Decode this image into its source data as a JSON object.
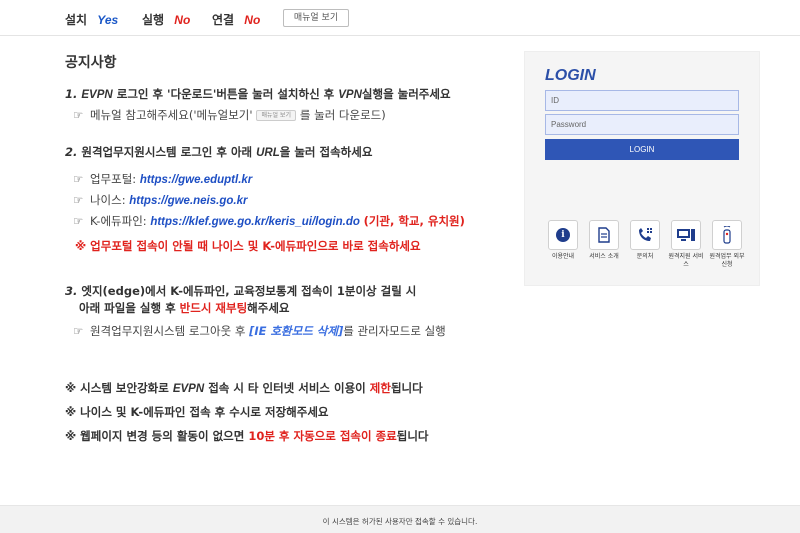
{
  "topbar": {
    "install_label": "설치",
    "install_value": "Yes",
    "run_label": "실행",
    "run_value": "No",
    "connect_label": "연결",
    "connect_value": "No",
    "manual_button": "매뉴얼 보기"
  },
  "notice": {
    "title": "공지사항",
    "item1": {
      "num": "1.",
      "evpn": "EVPN",
      "text_a": "로그인 후 '다운로드'버튼을 눌러 설치하신 후",
      "vpn": "VPN",
      "text_b": "실행을 눌러주세요",
      "sub_a": "메뉴얼 참고해주세요('메뉴얼보기'",
      "mini_btn": "매뉴얼 보기",
      "sub_b": "를 눌러 다운로드)"
    },
    "item2": {
      "num": "2.",
      "text_a": "원격업무지원시스템 로그인 후 아래",
      "url_word": "URL",
      "text_b": "을 눌러 접속하세요",
      "portal_label": "업무포털:",
      "portal_link": "https://gwe.eduptl.kr",
      "neis_label": "나이스:",
      "neis_link": "https://gwe.neis.go.kr",
      "k_label": "K-에듀파인:",
      "k_link": "https://klef.gwe.go.kr/keris_ui/login.do",
      "k_note": "(기관, 학교, 유치원)",
      "warning": "※ 업무포털 접속이 안될 때 나이스 및 K-에듀파인으로 바로 접속하세요"
    },
    "item3": {
      "num": "3.",
      "line1": "엣지(edge)에서 K-에듀파인, 교육정보통계 접속이 1분이상 걸릴 시",
      "line2_a": "아래 파일을 실행 후",
      "line2_red": "반드시 재부팅",
      "line2_b": "해주세요",
      "sub_a": "원격업무지원시스템 로그아웃 후",
      "sub_link": "[IE 호환모드 삭제]",
      "sub_b": "를 관리자모드로 실행"
    },
    "warn1_a": "※ 시스템 보안강화로",
    "warn1_evpn": "EVPN",
    "warn1_b": "접속 시 타 인터넷 서비스 이용이",
    "warn1_red": "제한",
    "warn1_c": "됩니다",
    "warn2": "※ 나이스 및 K-에듀파인 접속 후 수시로 저장해주세요",
    "warn3_a": "※ 웹페이지 변경 등의 활동이 없으면",
    "warn3_red": "10분 후 자동으로 접속이 종료",
    "warn3_b": "됩니다"
  },
  "login": {
    "title": "LOGIN",
    "id_placeholder": "ID",
    "pw_placeholder": "Password",
    "button": "LOGIN",
    "services": [
      {
        "label": "이용안내",
        "icon": "info-icon"
      },
      {
        "label": "서비스 소개",
        "icon": "document-icon"
      },
      {
        "label": "문의처",
        "icon": "phone-icon"
      },
      {
        "label": "원격지원 서비스",
        "icon": "remote-support-icon"
      },
      {
        "label": "원격업무 외부신청",
        "icon": "usb-key-icon"
      }
    ]
  },
  "footer": {
    "text": "이 시스템은 허가된 사용자만 접속할 수 있습니다."
  }
}
